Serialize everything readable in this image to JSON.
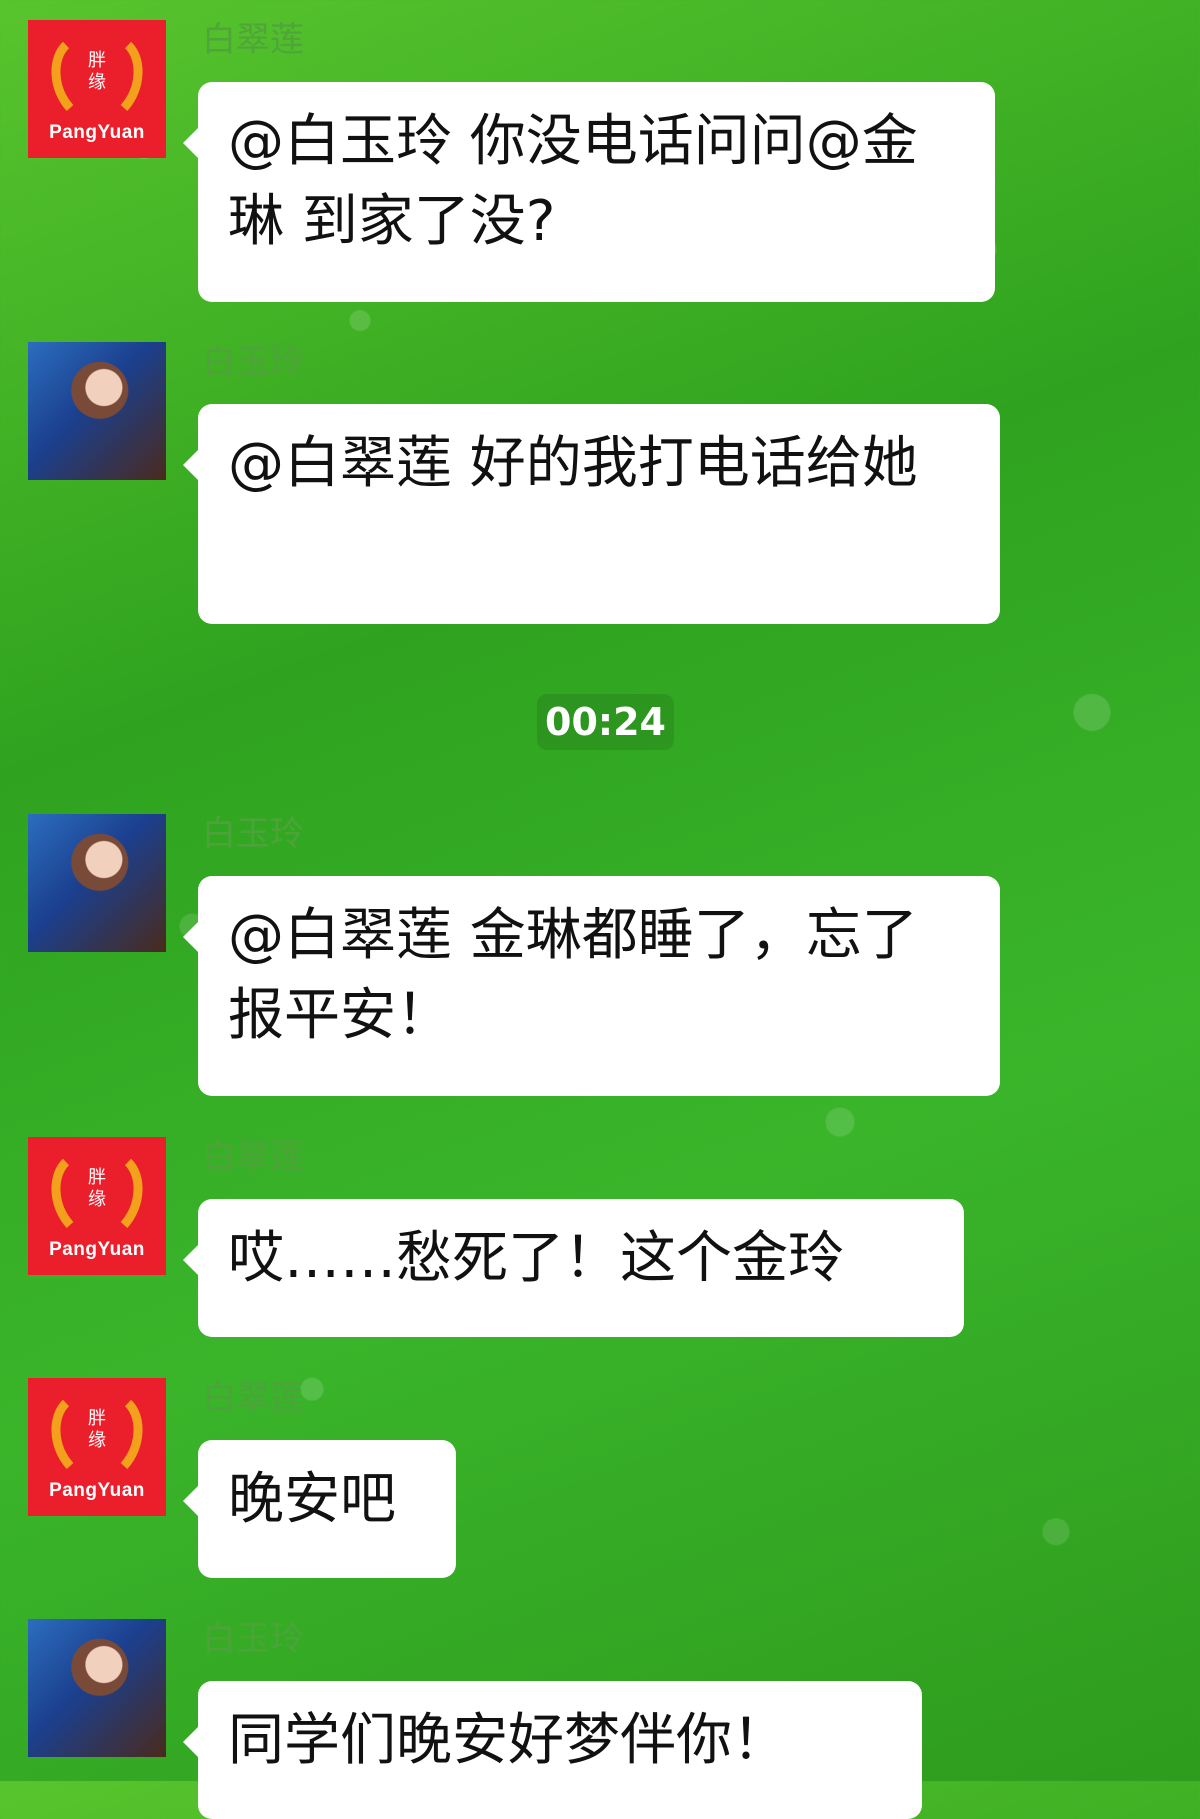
{
  "chat": {
    "messages": [
      {
        "sender": "白翠莲",
        "text": "@白玉玲 你没电话问问@金琳 到家了没?"
      },
      {
        "sender": "白玉玲",
        "text": "@白翠莲 好的我打电话给她"
      },
      {
        "sender": "白玉玲",
        "text": "@白翠莲 金琳都睡了，忘了报平安！"
      },
      {
        "sender": "白翠莲",
        "text": "哎……愁死了！这个金玲"
      },
      {
        "sender": "白翠莲",
        "text": "晚安吧"
      },
      {
        "sender": "白玉玲",
        "text": "同学们晚安好梦伴你！"
      }
    ],
    "time_separator": "00:24",
    "logo_text": "PangYuan",
    "logo_characters": "胖缘"
  },
  "colors": {
    "background": "#3ab52a",
    "bubble": "#ffffff",
    "logo_red": "#ea1f2b",
    "name_color": "#4fa33c"
  }
}
